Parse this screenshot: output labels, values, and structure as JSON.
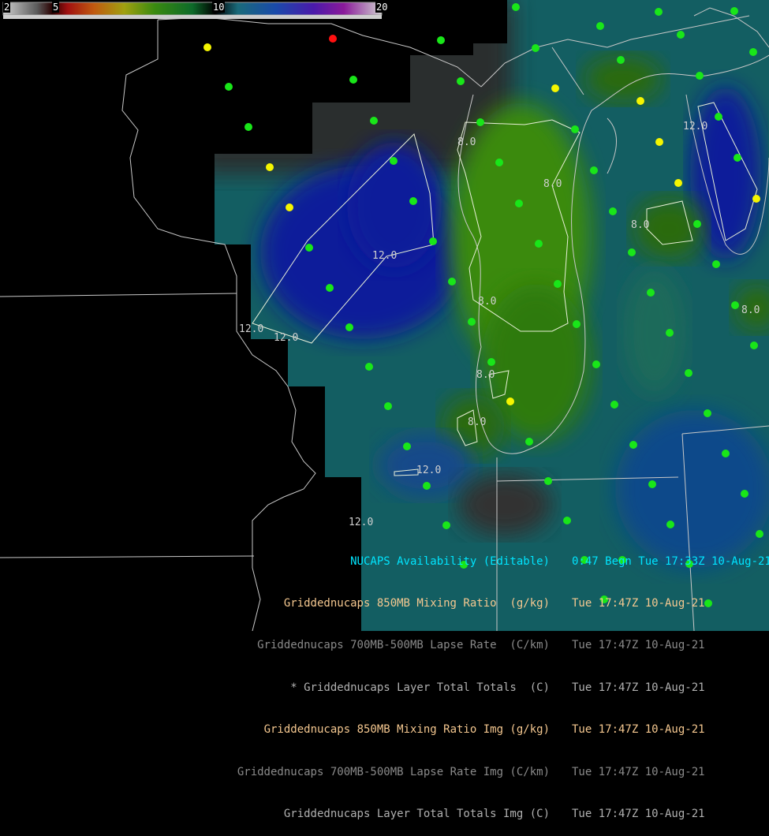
{
  "colorbar": {
    "ticks": [
      "2",
      "5",
      "10",
      "20"
    ]
  },
  "contours": {
    "labels": [
      "12.0",
      "12.0",
      "12.0",
      "12.0",
      "12.0",
      "12.0",
      "8.0",
      "8.0",
      "8.0",
      "8.0",
      "8.0",
      "8.0",
      "8.0"
    ]
  },
  "legend": {
    "rows": [
      {
        "name": "NUCAPS Availability (Editable)",
        "time": "0:47 Begn Tue 17:33Z 10-Aug-21",
        "color": "#00e5ff"
      },
      {
        "name": "Griddednucaps 850MB Mixing Ratio  (g/kg)",
        "time": "Tue 17:47Z 10-Aug-21",
        "color": "#f5c890"
      },
      {
        "name": "Griddednucaps 700MB-500MB Lapse Rate  (C/km)",
        "time": "Tue 17:47Z 10-Aug-21",
        "color": "#8a8a8a"
      },
      {
        "name": "* Griddednucaps Layer Total Totals  (C)",
        "time": "Tue 17:47Z 10-Aug-21",
        "color": "#b0b0b0"
      },
      {
        "name": "Griddednucaps 850MB Mixing Ratio Img (g/kg)",
        "time": "Tue 17:47Z 10-Aug-21",
        "color": "#f5c890"
      },
      {
        "name": "Griddednucaps 700MB-500MB Lapse Rate Img (C/km)",
        "time": "Tue 17:47Z 10-Aug-21",
        "color": "#8a8a8a"
      },
      {
        "name": "Griddednucaps Layer Total Totals Img (C)",
        "time": "Tue 17:47Z 10-Aug-21",
        "color": "#b0b0b0"
      }
    ]
  },
  "station_colors": {
    "green": "#19e619",
    "yellow": "#f5f500",
    "red": "#ff1010"
  }
}
